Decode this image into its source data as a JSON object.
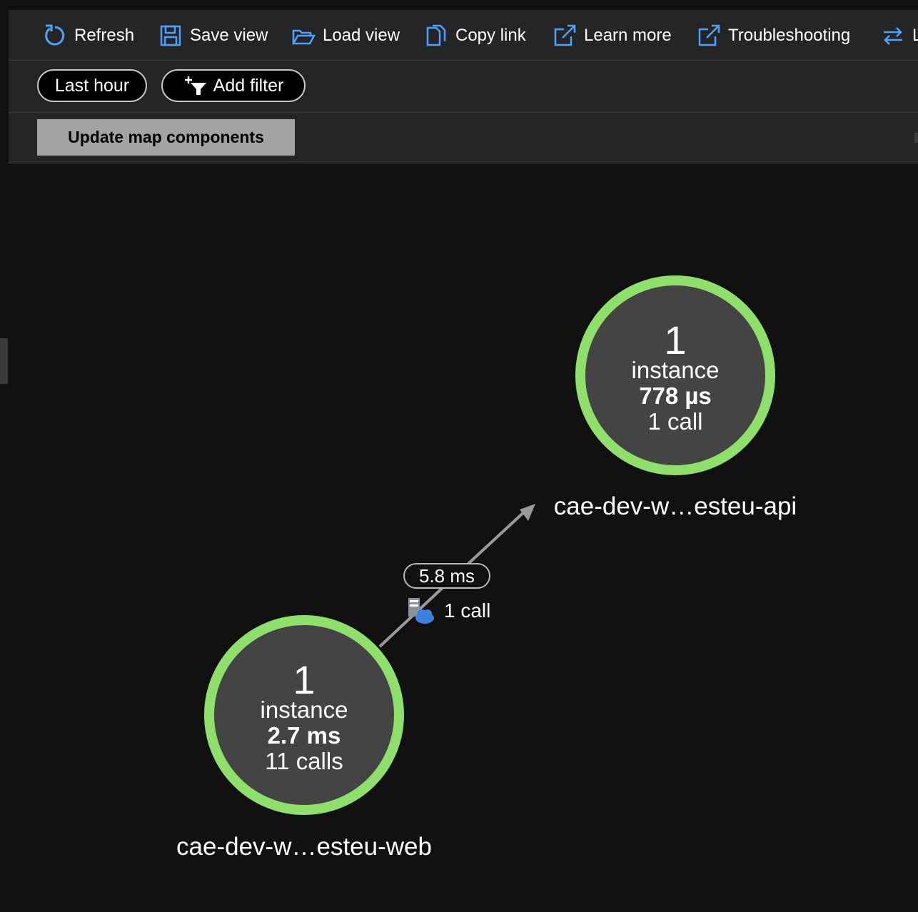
{
  "toolbar": {
    "refresh": {
      "label": "Refresh",
      "icon": "refresh-icon"
    },
    "save_view": {
      "label": "Save view",
      "icon": "save-icon"
    },
    "load_view": {
      "label": "Load view",
      "icon": "folder-open-icon"
    },
    "copy_link": {
      "label": "Copy link",
      "icon": "copy-icon"
    },
    "learn_more": {
      "label": "Learn more",
      "icon": "external-link-icon"
    },
    "troubleshooting": {
      "label": "Troubleshooting",
      "icon": "external-link-icon"
    },
    "truncated": {
      "label": "L",
      "icon": "swap-arrows-icon"
    }
  },
  "filters": {
    "time_range": "Last hour",
    "add_filter": "Add filter",
    "add_filter_icon": "add-filter-icon"
  },
  "update_button": "Update map components",
  "map": {
    "nodes": [
      {
        "id": "web",
        "count": "1",
        "unit": "instance",
        "duration": "2.7 ms",
        "calls": "11 calls",
        "label": "cae-dev-w…esteu-web",
        "status_color": "#8ee06a"
      },
      {
        "id": "api",
        "count": "1",
        "unit": "instance",
        "duration": "778 µs",
        "calls": "1 call",
        "label": "cae-dev-w…esteu-api",
        "status_color": "#8ee06a"
      }
    ],
    "edge": {
      "from": "web",
      "to": "api",
      "duration": "5.8 ms",
      "calls": "1 call",
      "icon": "cloud-server-icon"
    }
  },
  "colors": {
    "background": "#111111",
    "toolbar": "#252526",
    "healthy": "#8ee06a",
    "accent_icon": "#4aa3ff"
  }
}
